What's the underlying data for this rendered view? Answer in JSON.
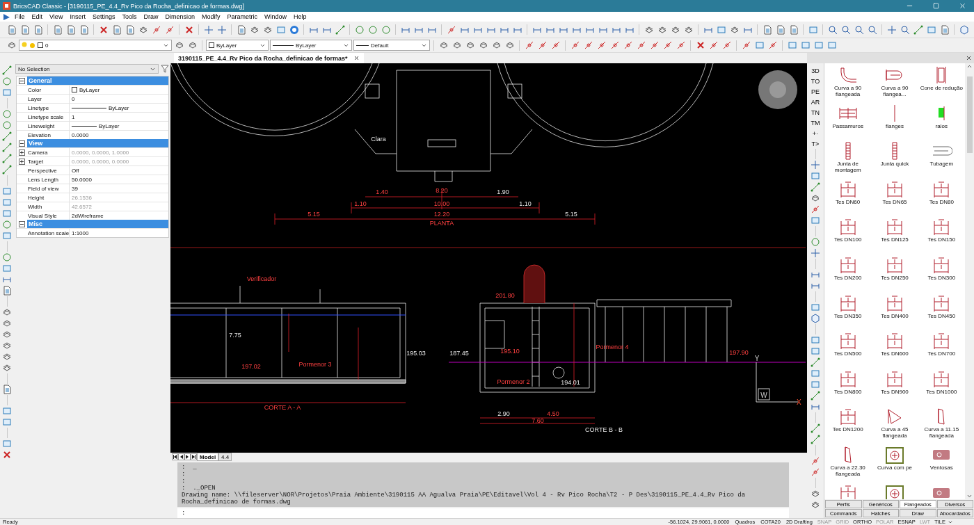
{
  "window": {
    "title": "BricsCAD Classic - [3190115_PE_4.4_Rv Pico da Rocha_definicao de formas.dwg]"
  },
  "menu": [
    "File",
    "Edit",
    "View",
    "Insert",
    "Settings",
    "Tools",
    "Draw",
    "Dimension",
    "Modify",
    "Parametric",
    "Window",
    "Help"
  ],
  "layer_bar": {
    "layer": "0",
    "color_setting": "ByLayer",
    "linetype": "ByLayer",
    "lineweight": "Default"
  },
  "document_tab": {
    "title": "3190115_PE_4.4_Rv Pico da Rocha_definicao de formas*"
  },
  "properties": {
    "selection": "No Selection",
    "sections": [
      {
        "title": "General",
        "expanded": true,
        "rows": [
          {
            "label": "Color",
            "value": "ByLayer",
            "kind": "color",
            "disabled": false,
            "expandable": false
          },
          {
            "label": "Layer",
            "value": "0",
            "kind": "text",
            "disabled": false,
            "expandable": false
          },
          {
            "label": "Linetype",
            "value": "ByLayer",
            "kind": "line",
            "disabled": false,
            "expandable": false
          },
          {
            "label": "Linetype scale",
            "value": "1",
            "kind": "text",
            "disabled": false,
            "expandable": false
          },
          {
            "label": "Lineweight",
            "value": "ByLayer",
            "kind": "line",
            "disabled": false,
            "expandable": false
          },
          {
            "label": "Elevation",
            "value": "0.0000",
            "kind": "text",
            "disabled": false,
            "expandable": false
          }
        ]
      },
      {
        "title": "View",
        "expanded": true,
        "rows": [
          {
            "label": "Camera",
            "value": "0.0000, 0.0000, 1.0000",
            "kind": "text",
            "disabled": true,
            "expandable": true
          },
          {
            "label": "Target",
            "value": "0.0000, 0.0000, 0.0000",
            "kind": "text",
            "disabled": true,
            "expandable": true
          },
          {
            "label": "Perspective",
            "value": "Off",
            "kind": "text",
            "disabled": false,
            "expandable": false
          },
          {
            "label": "Lens Length",
            "value": "50.0000",
            "kind": "text",
            "disabled": false,
            "expandable": false
          },
          {
            "label": "Field of view",
            "value": "39",
            "kind": "text",
            "disabled": false,
            "expandable": false
          },
          {
            "label": "Height",
            "value": "26.1536",
            "kind": "text",
            "disabled": true,
            "expandable": false
          },
          {
            "label": "Width",
            "value": "42.6572",
            "kind": "text",
            "disabled": true,
            "expandable": false
          },
          {
            "label": "Visual Style",
            "value": "2dWireframe",
            "kind": "text",
            "disabled": false,
            "expandable": false
          }
        ]
      },
      {
        "title": "Misc",
        "expanded": true,
        "rows": [
          {
            "label": "Annotation scale",
            "value": "1:1000",
            "kind": "text",
            "disabled": false,
            "expandable": false
          }
        ]
      }
    ]
  },
  "drawing": {
    "labels": [
      "Clara",
      "1.40",
      "8.20",
      "1.90",
      "1.10",
      "10.00",
      "1.10",
      "5.15",
      "12.20",
      "5.15",
      "PLANTA",
      "Verificador",
      "7.75",
      "197.02",
      "Pormenor 3",
      "195.03",
      "CORTE A - A",
      "201.80",
      "187.45",
      "195.10",
      "Pormenor 2",
      "194.01",
      "Pormenor 4",
      "197.90",
      "2.90",
      "4.50",
      "7.60",
      "CORTE B - B"
    ],
    "ucs": {
      "y": "Y",
      "x": "X",
      "w": "W"
    }
  },
  "layout_tabs": [
    {
      "label": "Model",
      "selected": true
    },
    {
      "label": "4.4",
      "selected": false
    }
  ],
  "command": {
    "history": [
      ":  _",
      ":",
      ":",
      ":  ._OPEN",
      "Drawing name: \\\\fileserver\\NOR\\Projetos\\Praia Ambiente\\3190115 AA Agualva Praia\\PE\\Editavel\\Vol 4 - Rv Pico Rocha\\T2 - P Des\\3190115_PE_4.4_Rv Pico da Rocha_definicao de formas.dwg"
    ],
    "prompt": ":"
  },
  "palette": {
    "shortcuts": [
      "3D",
      "TO",
      "PE",
      "AR",
      "TN",
      "TM",
      "+·",
      "T>"
    ],
    "items": [
      {
        "label": "Curva a 90 flangeada",
        "kind": "bend"
      },
      {
        "label": "Curva a 90 flangea...",
        "kind": "bend2"
      },
      {
        "label": "Cone de redução",
        "kind": "cone"
      },
      {
        "label": "Passamuros",
        "kind": "pipe"
      },
      {
        "label": "flanges",
        "kind": "flange"
      },
      {
        "label": "ralos",
        "kind": "drain"
      },
      {
        "label": "Junta de montagem",
        "kind": "joint"
      },
      {
        "label": "Junta quick",
        "kind": "joint"
      },
      {
        "label": "Tubagem",
        "kind": "tube"
      },
      {
        "label": "Tes DN60",
        "kind": "tee"
      },
      {
        "label": "Tes DN65",
        "kind": "tee"
      },
      {
        "label": "Tes DN80",
        "kind": "tee"
      },
      {
        "label": "Tes DN100",
        "kind": "tee"
      },
      {
        "label": "Tes DN125",
        "kind": "tee"
      },
      {
        "label": "Tes DN150",
        "kind": "tee"
      },
      {
        "label": "Tes DN200",
        "kind": "tee"
      },
      {
        "label": "Tes DN250",
        "kind": "tee"
      },
      {
        "label": "Tes DN300",
        "kind": "tee"
      },
      {
        "label": "Tes DN350",
        "kind": "tee"
      },
      {
        "label": "Tes DN400",
        "kind": "tee"
      },
      {
        "label": "Tes DN450",
        "kind": "tee"
      },
      {
        "label": "Tes DN500",
        "kind": "tee"
      },
      {
        "label": "Tes DN600",
        "kind": "tee"
      },
      {
        "label": "Tes DN700",
        "kind": "tee"
      },
      {
        "label": "Tes DN800",
        "kind": "tee"
      },
      {
        "label": "Tes DN900",
        "kind": "tee"
      },
      {
        "label": "Tes DN1000",
        "kind": "tee"
      },
      {
        "label": "Tes DN1200",
        "kind": "tee"
      },
      {
        "label": "Curva a 45 flangeada",
        "kind": "bend45"
      },
      {
        "label": "Curva a 11.15 flangeada",
        "kind": "bend11"
      },
      {
        "label": "Curva a 22.30 flangeada",
        "kind": "bend11"
      },
      {
        "label": "Curva com pe",
        "kind": "foot"
      },
      {
        "label": "Ventosas",
        "kind": "valve"
      }
    ],
    "tabs": [
      {
        "label": "Perfis",
        "selected": false
      },
      {
        "label": "Genéricos",
        "selected": false
      },
      {
        "label": "Flangeados",
        "selected": true
      },
      {
        "label": "Diversos",
        "selected": false
      },
      {
        "label": "Commands",
        "selected": false
      },
      {
        "label": "Hatches",
        "selected": false
      },
      {
        "label": "Draw",
        "selected": false
      },
      {
        "label": "Abocardados",
        "selected": false
      }
    ]
  },
  "status_bar": {
    "message": "Ready",
    "coordinates": "-56.1024, 29.9061, 0.0000",
    "fields": [
      "Quadros",
      "COTA20",
      "2D Drafting"
    ],
    "toggles": [
      {
        "label": "SNAP",
        "on": false
      },
      {
        "label": "GRID",
        "on": false
      },
      {
        "label": "ORTHO",
        "on": true
      },
      {
        "label": "POLAR",
        "on": false
      },
      {
        "label": "ESNAP",
        "on": true
      },
      {
        "label": "LWT",
        "on": false
      },
      {
        "label": "TILE",
        "on": true
      }
    ]
  }
}
